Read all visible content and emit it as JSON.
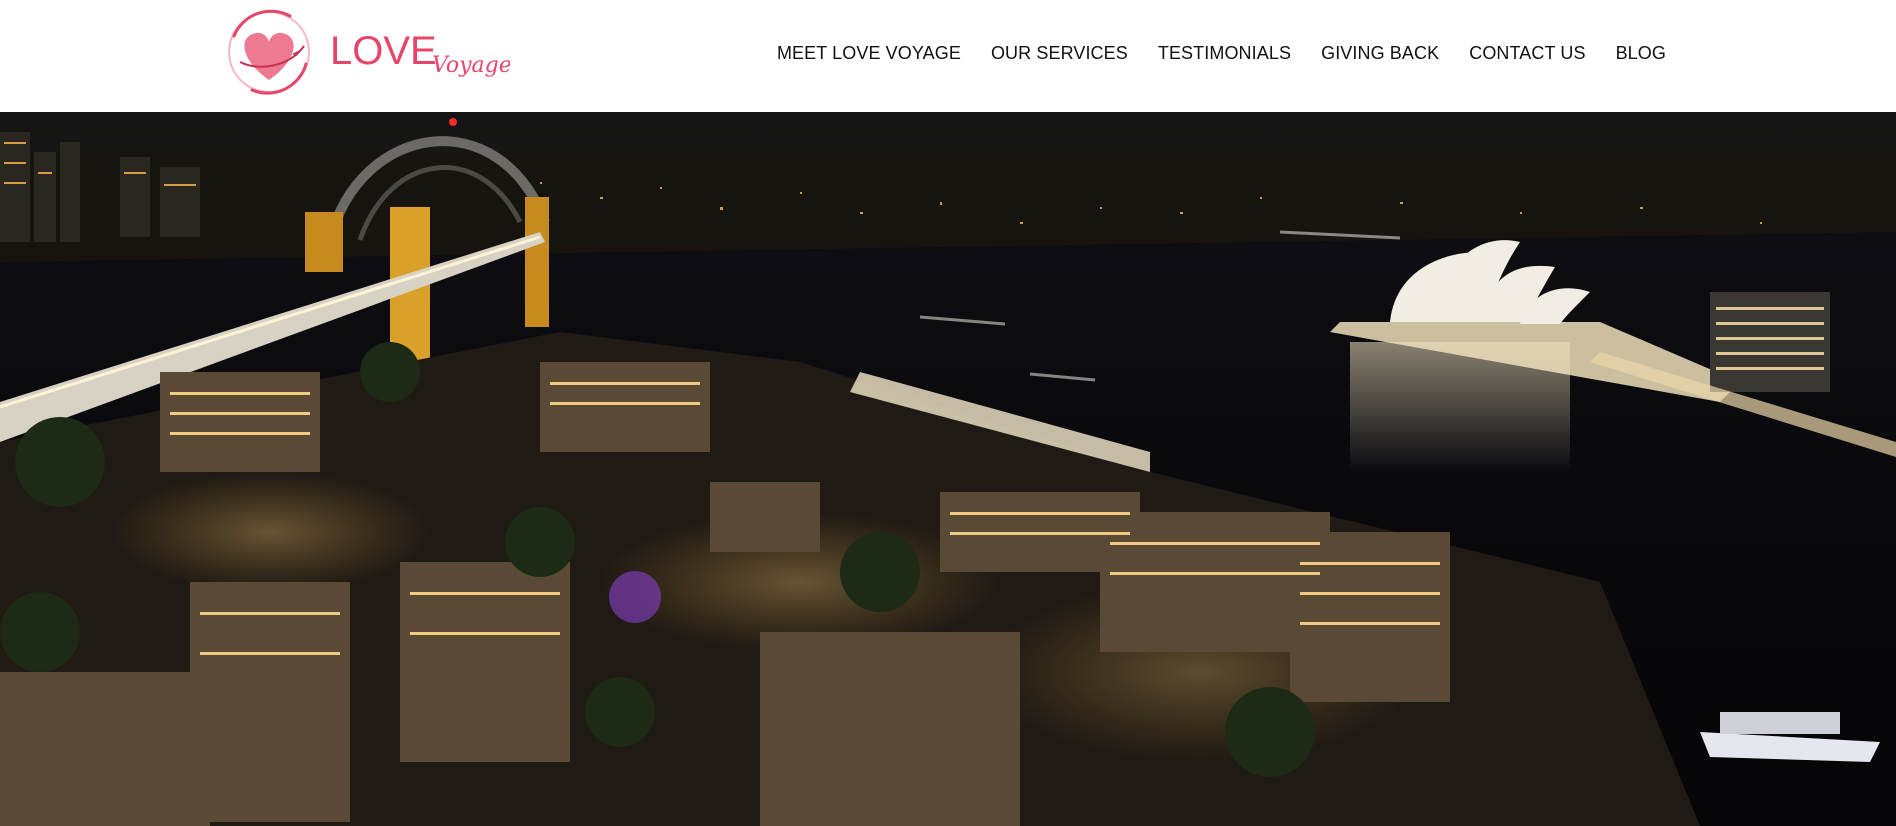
{
  "header": {
    "logo": {
      "word1": "LOVE",
      "word2": "Voyage",
      "icon": "heart-globe-icon"
    },
    "nav": [
      {
        "label": "MEET LOVE VOYAGE"
      },
      {
        "label": "OUR SERVICES"
      },
      {
        "label": "TESTIMONIALS"
      },
      {
        "label": "GIVING BACK"
      },
      {
        "label": "CONTACT US"
      },
      {
        "label": "BLOG"
      }
    ]
  },
  "colors": {
    "brand": "#e8456a",
    "nav_text": "#111111",
    "night_sky": "#0b0b0c",
    "harbour_water": "#0a0a0d",
    "city_lights": "#f4b24a"
  }
}
